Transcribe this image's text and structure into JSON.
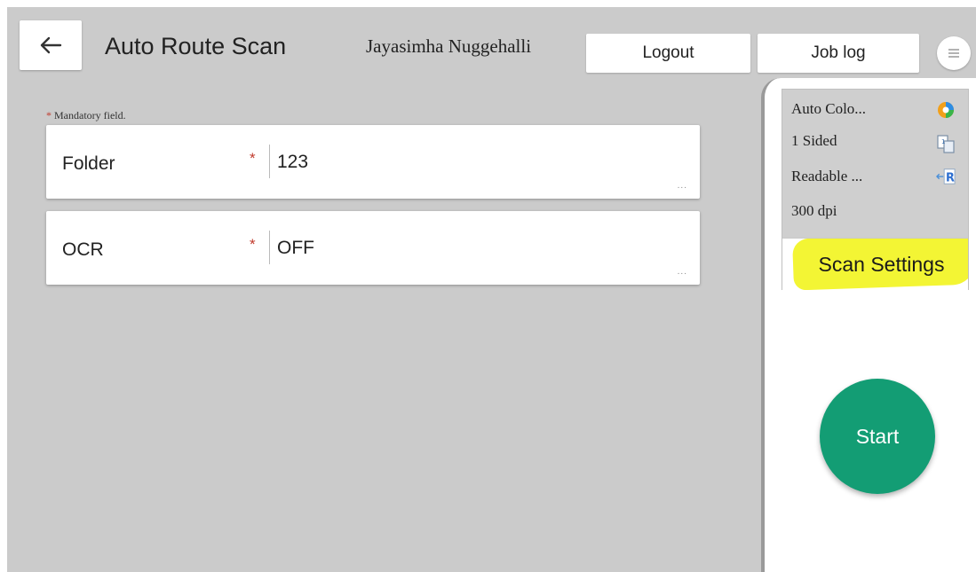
{
  "header": {
    "title": "Auto Route Scan",
    "user": "Jayasimha Nuggehalli",
    "logout_label": "Logout",
    "joblog_label": "Job log"
  },
  "form": {
    "mandatory_marker": "*",
    "mandatory_note": "Mandatory field.",
    "fields": [
      {
        "label": "Folder",
        "required": "*",
        "value": "123",
        "more": "..."
      },
      {
        "label": "OCR",
        "required": "*",
        "value": "OFF",
        "more": "..."
      }
    ]
  },
  "scan_settings": {
    "items": [
      {
        "text": "Auto Colo...",
        "icon": "auto-color-icon"
      },
      {
        "text": "1 Sided",
        "icon": "one-sided-icon"
      },
      {
        "text": "Readable ...",
        "icon": "readable-direction-icon"
      },
      {
        "text": "300 dpi",
        "icon": ""
      }
    ],
    "button_label": "Scan Settings",
    "highlight_color": "#f3f534"
  },
  "start": {
    "label": "Start",
    "color": "#139d74"
  }
}
